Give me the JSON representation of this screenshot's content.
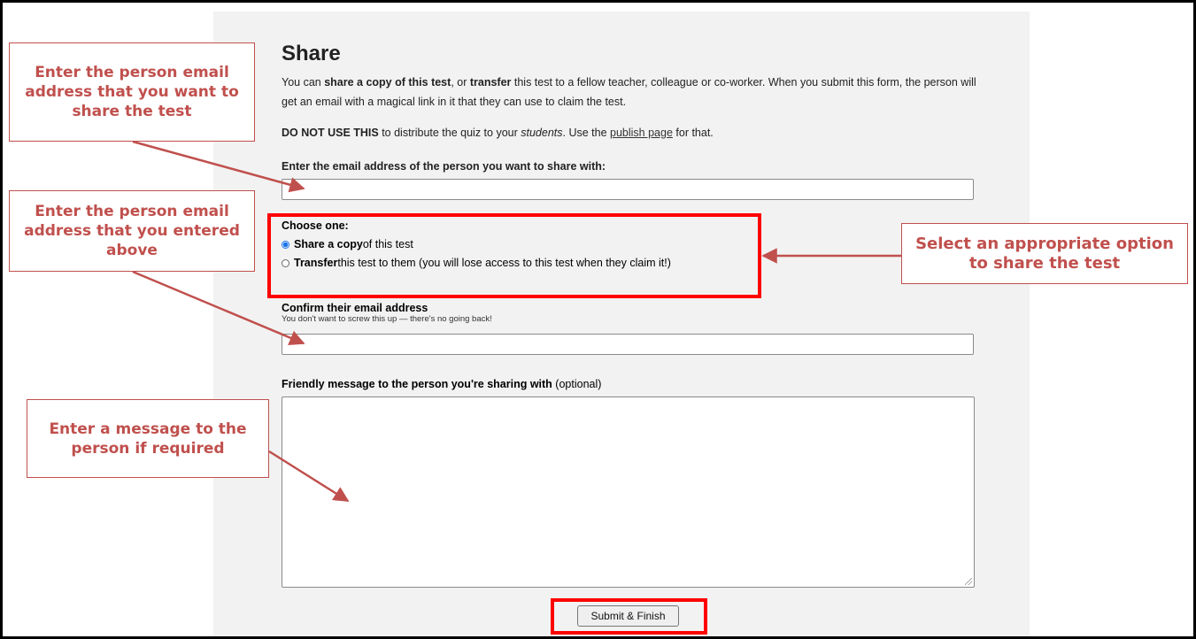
{
  "form": {
    "title": "Share",
    "intro": {
      "t1": "You can ",
      "b1": "share a copy of this test",
      "t2": ", or ",
      "b2": "transfer",
      "t3": " this test to a fellow teacher, colleague or co-worker. When you submit this form, the person will get an email with a magical link in it that they can use to claim the test."
    },
    "warning": {
      "b1": "DO NOT USE THIS",
      "t1": " to distribute the quiz to your ",
      "i1": "students",
      "t2": ". Use the ",
      "link": "publish page",
      "t3": " for that."
    },
    "email_label": "Enter the email address of the person you want to share with:",
    "email_value": "",
    "choose_title": "Choose one:",
    "option_copy": {
      "bold": "Share a copy",
      "rest": " of this test",
      "selected": true
    },
    "option_transfer": {
      "bold": "Transfer",
      "rest": " this test to them (you will lose access to this test when they claim it!)",
      "selected": false
    },
    "confirm_label": "Confirm their email address",
    "confirm_hint": "You don't want to screw this up — there's no going back!",
    "confirm_value": "",
    "message_label_bold": "Friendly message to the person you're sharing with",
    "message_label_optional": " (optional)",
    "message_value": "",
    "submit_label": "Submit & Finish"
  },
  "annotations": {
    "callout_email": "Enter the person email address that you want to share the test",
    "callout_confirm": "Enter the person email address that you entered above",
    "callout_message": "Enter a message to the person if required",
    "callout_option": "Select an appropriate option to share the test",
    "color": "#c0504d",
    "highlight_color": "#ff0000"
  }
}
